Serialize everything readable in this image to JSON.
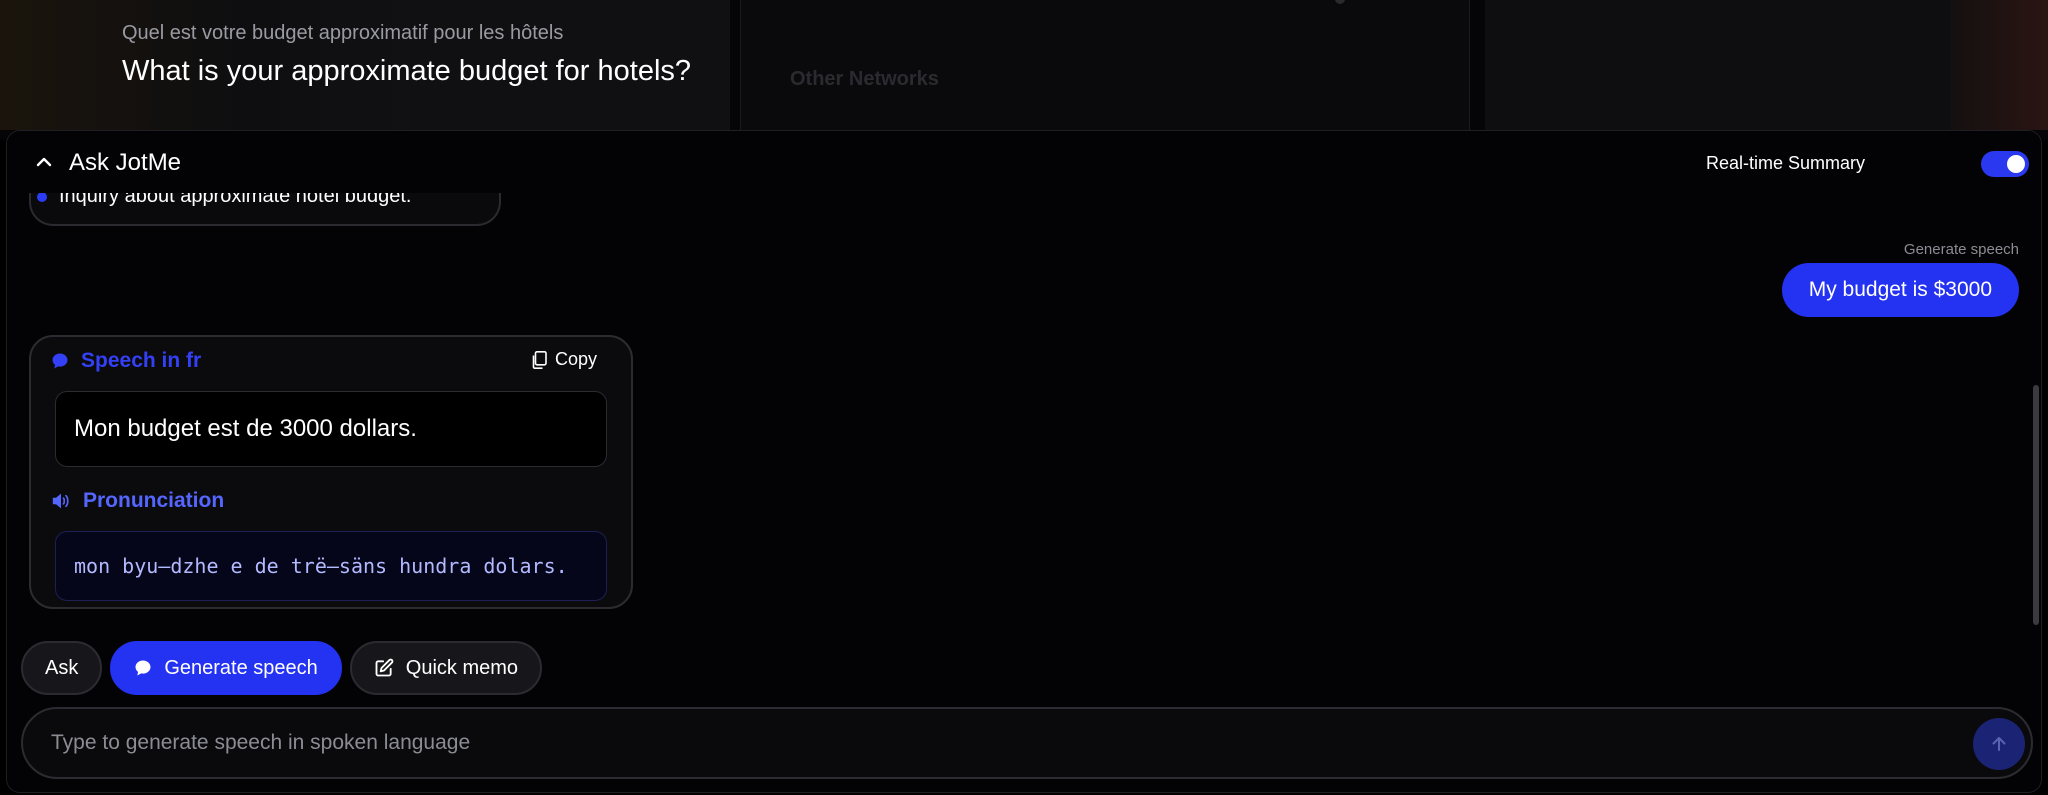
{
  "background": {
    "other_networks": "Other Networks",
    "question_fr": "Quel est votre budget approximatif pour les hôtels",
    "question_en": "What is your approximate budget for hotels?"
  },
  "header": {
    "title": "Ask JotMe",
    "realtime_label": "Real-time Summary",
    "realtime_on": true,
    "accent": "#2a39f0"
  },
  "summary": {
    "items": [
      "Inquiry about approximate hotel budget."
    ]
  },
  "user_message": {
    "label": "Generate speech",
    "text": "My budget is $3000"
  },
  "speech": {
    "title": "Speech in fr",
    "copy_label": "Copy",
    "text": "Mon budget est de 3000 dollars.",
    "pronunciation_title": "Pronunciation",
    "pronunciation": "mon byu–dzhe e de trë–säns hundra dolars."
  },
  "modes": {
    "ask": "Ask",
    "generate_speech": "Generate speech",
    "quick_memo": "Quick memo",
    "active": "generate_speech"
  },
  "input": {
    "placeholder": "Type to generate speech in spoken language",
    "value": ""
  },
  "icons": {
    "collapse": "chevron-up-icon",
    "speech": "chat-bubble-icon",
    "copy": "copy-icon",
    "pronunciation": "speaker-icon",
    "memo": "edit-icon",
    "send": "arrow-up-icon"
  }
}
